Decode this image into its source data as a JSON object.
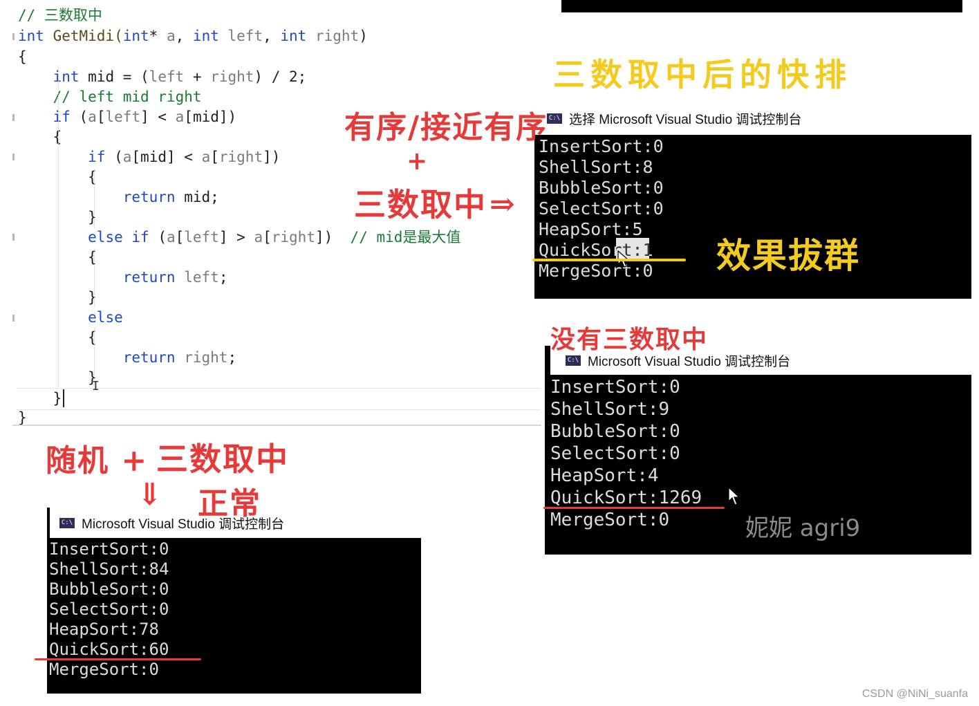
{
  "editor": {
    "lines": [
      {
        "parts": [
          {
            "t": "// 三数取中",
            "c": "cm"
          }
        ]
      },
      {
        "parts": [
          {
            "t": "int",
            "c": "kw"
          },
          {
            "t": " GetMidi(",
            "c": "fn"
          },
          {
            "t": "int",
            "c": "kw"
          },
          {
            "t": "* ",
            "c": ""
          },
          {
            "t": "a",
            "c": "pm"
          },
          {
            "t": ", ",
            "c": ""
          },
          {
            "t": "int",
            "c": "kw"
          },
          {
            "t": " ",
            "c": ""
          },
          {
            "t": "left",
            "c": "pm"
          },
          {
            "t": ", ",
            "c": ""
          },
          {
            "t": "int",
            "c": "kw"
          },
          {
            "t": " ",
            "c": ""
          },
          {
            "t": "right",
            "c": "pm"
          },
          {
            "t": ")",
            "c": ""
          }
        ]
      },
      {
        "parts": [
          {
            "t": "{",
            "c": ""
          }
        ]
      },
      {
        "parts": [
          {
            "t": "    ",
            "c": ""
          },
          {
            "t": "int",
            "c": "kw"
          },
          {
            "t": " mid = (",
            "c": ""
          },
          {
            "t": "left",
            "c": "pm"
          },
          {
            "t": " + ",
            "c": ""
          },
          {
            "t": "right",
            "c": "pm"
          },
          {
            "t": ") / 2;",
            "c": ""
          }
        ]
      },
      {
        "parts": [
          {
            "t": "    // left mid right",
            "c": "cm"
          }
        ]
      },
      {
        "parts": [
          {
            "t": "    ",
            "c": ""
          },
          {
            "t": "if",
            "c": "kw"
          },
          {
            "t": " (",
            "c": ""
          },
          {
            "t": "a",
            "c": "pm"
          },
          {
            "t": "[",
            "c": ""
          },
          {
            "t": "left",
            "c": "pm"
          },
          {
            "t": "] < ",
            "c": ""
          },
          {
            "t": "a",
            "c": "pm"
          },
          {
            "t": "[mid])",
            "c": ""
          }
        ]
      },
      {
        "parts": [
          {
            "t": "    {",
            "c": ""
          }
        ]
      },
      {
        "parts": [
          {
            "t": "        ",
            "c": ""
          },
          {
            "t": "if",
            "c": "kw"
          },
          {
            "t": " (",
            "c": ""
          },
          {
            "t": "a",
            "c": "pm"
          },
          {
            "t": "[mid] < ",
            "c": ""
          },
          {
            "t": "a",
            "c": "pm"
          },
          {
            "t": "[",
            "c": ""
          },
          {
            "t": "right",
            "c": "pm"
          },
          {
            "t": "])",
            "c": ""
          }
        ]
      },
      {
        "parts": [
          {
            "t": "        {",
            "c": ""
          }
        ]
      },
      {
        "parts": [
          {
            "t": "            ",
            "c": ""
          },
          {
            "t": "return",
            "c": "kw"
          },
          {
            "t": " mid;",
            "c": ""
          }
        ]
      },
      {
        "parts": [
          {
            "t": "        }",
            "c": ""
          }
        ]
      },
      {
        "parts": [
          {
            "t": "        ",
            "c": ""
          },
          {
            "t": "else if",
            "c": "kw"
          },
          {
            "t": " (",
            "c": ""
          },
          {
            "t": "a",
            "c": "pm"
          },
          {
            "t": "[",
            "c": ""
          },
          {
            "t": "left",
            "c": "pm"
          },
          {
            "t": "] > ",
            "c": ""
          },
          {
            "t": "a",
            "c": "pm"
          },
          {
            "t": "[",
            "c": ""
          },
          {
            "t": "right",
            "c": "pm"
          },
          {
            "t": "])  ",
            "c": ""
          },
          {
            "t": "// mid是最大值",
            "c": "cm"
          }
        ]
      },
      {
        "parts": [
          {
            "t": "        {",
            "c": ""
          }
        ]
      },
      {
        "parts": [
          {
            "t": "            ",
            "c": ""
          },
          {
            "t": "return",
            "c": "kw"
          },
          {
            "t": " ",
            "c": ""
          },
          {
            "t": "left",
            "c": "pm"
          },
          {
            "t": ";",
            "c": ""
          }
        ]
      },
      {
        "parts": [
          {
            "t": "        }",
            "c": ""
          }
        ]
      },
      {
        "parts": [
          {
            "t": "        ",
            "c": ""
          },
          {
            "t": "else",
            "c": "kw"
          }
        ]
      },
      {
        "parts": [
          {
            "t": "        {",
            "c": ""
          }
        ]
      },
      {
        "parts": [
          {
            "t": "            ",
            "c": ""
          },
          {
            "t": "return",
            "c": "kw"
          },
          {
            "t": " ",
            "c": ""
          },
          {
            "t": "right",
            "c": "pm"
          },
          {
            "t": ";",
            "c": ""
          }
        ]
      },
      {
        "parts": [
          {
            "t": "        }",
            "c": ""
          }
        ]
      },
      {
        "parts": [
          {
            "t": "    }",
            "c": ""
          }
        ]
      },
      {
        "parts": [
          {
            "t": "}",
            "c": ""
          }
        ]
      }
    ]
  },
  "console_a": {
    "title": "选择 Microsoft Visual Studio 调试控制台",
    "icon": "C:\\",
    "lines": [
      "InsertSort:0",
      "ShellSort:8",
      "BubbleSort:0",
      "SelectSort:0",
      "HeapSort:5",
      "QuickSort:1",
      "MergeSort:0"
    ]
  },
  "console_b": {
    "title": "Microsoft Visual Studio 调试控制台",
    "icon": "C:\\",
    "lines": [
      "InsertSort:0",
      "ShellSort:9",
      "BubbleSort:0",
      "SelectSort:0",
      "HeapSort:4",
      "QuickSort:1269",
      "MergeSort:0"
    ]
  },
  "console_c": {
    "title": "Microsoft Visual Studio 调试控制台",
    "icon": "C:\\",
    "lines": [
      "InsertSort:0",
      "ShellSort:84",
      "BubbleSort:0",
      "SelectSort:0",
      "HeapSort:78",
      "QuickSort:60",
      "MergeSort:0"
    ]
  },
  "annotations": {
    "title_yellow": "三数取中后的快排",
    "ordered_red": "有序/接近有序",
    "plus": "+",
    "three_mid_red": "三数取中",
    "arrow": "⇒",
    "effect_yellow": "效果拔群",
    "without_red": "没有三数取中",
    "random_red": "随机 +",
    "random_three_red": "三数取中",
    "down_arrow": "⇓",
    "normal_red": "正常"
  },
  "watermark": "妮妮 agri9",
  "csdn_credit": "CSDN @NiNi_suanfa",
  "colors": {
    "red": "#e43a3a",
    "yellow": "#f2cb1e",
    "keyword": "#1f49c4",
    "comment": "#1d7a34",
    "console_bg": "#000000"
  }
}
